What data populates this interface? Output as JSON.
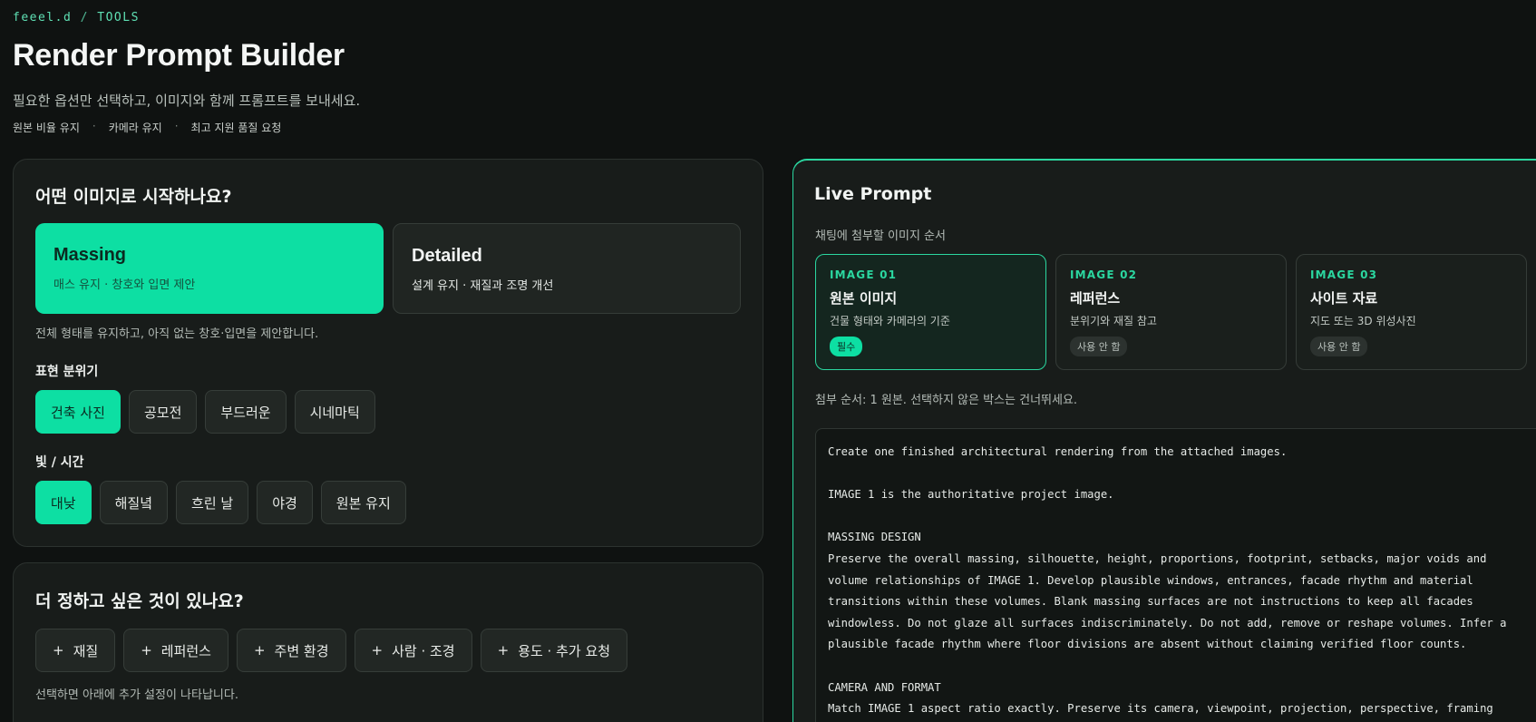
{
  "brand": {
    "name": "feeel.d",
    "sep": "/",
    "section": "TOOLS"
  },
  "header": {
    "title": "Render Prompt Builder",
    "subtitle": "필요한 옵션만 선택하고, 이미지와 함께 프롬프트를 보내세요.",
    "tags": [
      "원본 비율 유지",
      "카메라 유지",
      "최고 지원 품질 요청"
    ],
    "tag_separator": "·"
  },
  "start": {
    "heading": "어떤 이미지로 시작하나요?",
    "modes": [
      {
        "title": "Massing",
        "desc": "매스 유지 · 창호와 입면 제안",
        "active": true
      },
      {
        "title": "Detailed",
        "desc": "설계 유지 · 재질과 조명 개선",
        "active": false
      }
    ],
    "mode_note": "전체 형태를 유지하고, 아직 없는 창호·입면을 제안합니다.",
    "mood_label": "표현 분위기",
    "moods": [
      "건축 사진",
      "공모전",
      "부드러운",
      "시네마틱"
    ],
    "light_label": "빛 / 시간",
    "lights": [
      "대낮",
      "해질녘",
      "흐린 날",
      "야경",
      "원본 유지"
    ]
  },
  "more": {
    "heading": "더 정하고 싶은 것이 있나요?",
    "plus": "+",
    "options": [
      "재질",
      "레퍼런스",
      "주변 환경",
      "사람 · 조경",
      "용도 · 추가 요청"
    ],
    "note": "선택하면 아래에 추가 설정이 나타납니다."
  },
  "live": {
    "heading": "Live Prompt",
    "sub": "채팅에 첨부할 이미지 순서",
    "slots": [
      {
        "id": "IMAGE 01",
        "name": "원본 이미지",
        "desc": "건물 형태와 카메라의 기준",
        "badge": "필수",
        "active": true
      },
      {
        "id": "IMAGE 02",
        "name": "레퍼런스",
        "desc": "분위기와 재질 참고",
        "badge": "사용 안 함",
        "active": false
      },
      {
        "id": "IMAGE 03",
        "name": "사이트 자료",
        "desc": "지도 또는 3D 위성사진",
        "badge": "사용 안 함",
        "active": false
      }
    ],
    "order_note": "첨부 순서: 1 원본. 선택하지 않은 박스는 건너뛰세요.",
    "prompt": "Create one finished architectural rendering from the attached images.\n\nIMAGE 1 is the authoritative project image.\n\nMASSING DESIGN\nPreserve the overall massing, silhouette, height, proportions, footprint, setbacks, major voids and\nvolume relationships of IMAGE 1. Develop plausible windows, entrances, facade rhythm and material\ntransitions within these volumes. Blank massing surfaces are not instructions to keep all facades\nwindowless. Do not glaze all surfaces indiscriminately. Do not add, remove or reshape volumes. Infer a\nplausible facade rhythm where floor divisions are absent without claiming verified floor counts.\n\nCAMERA AND FORMAT\nMatch IMAGE 1 aspect ratio exactly. Preserve its camera, viewpoint, projection, perspective, framing"
  },
  "colors": {
    "accent": "#0ddfa3",
    "background": "#0f1211",
    "card": "#181c1a"
  }
}
